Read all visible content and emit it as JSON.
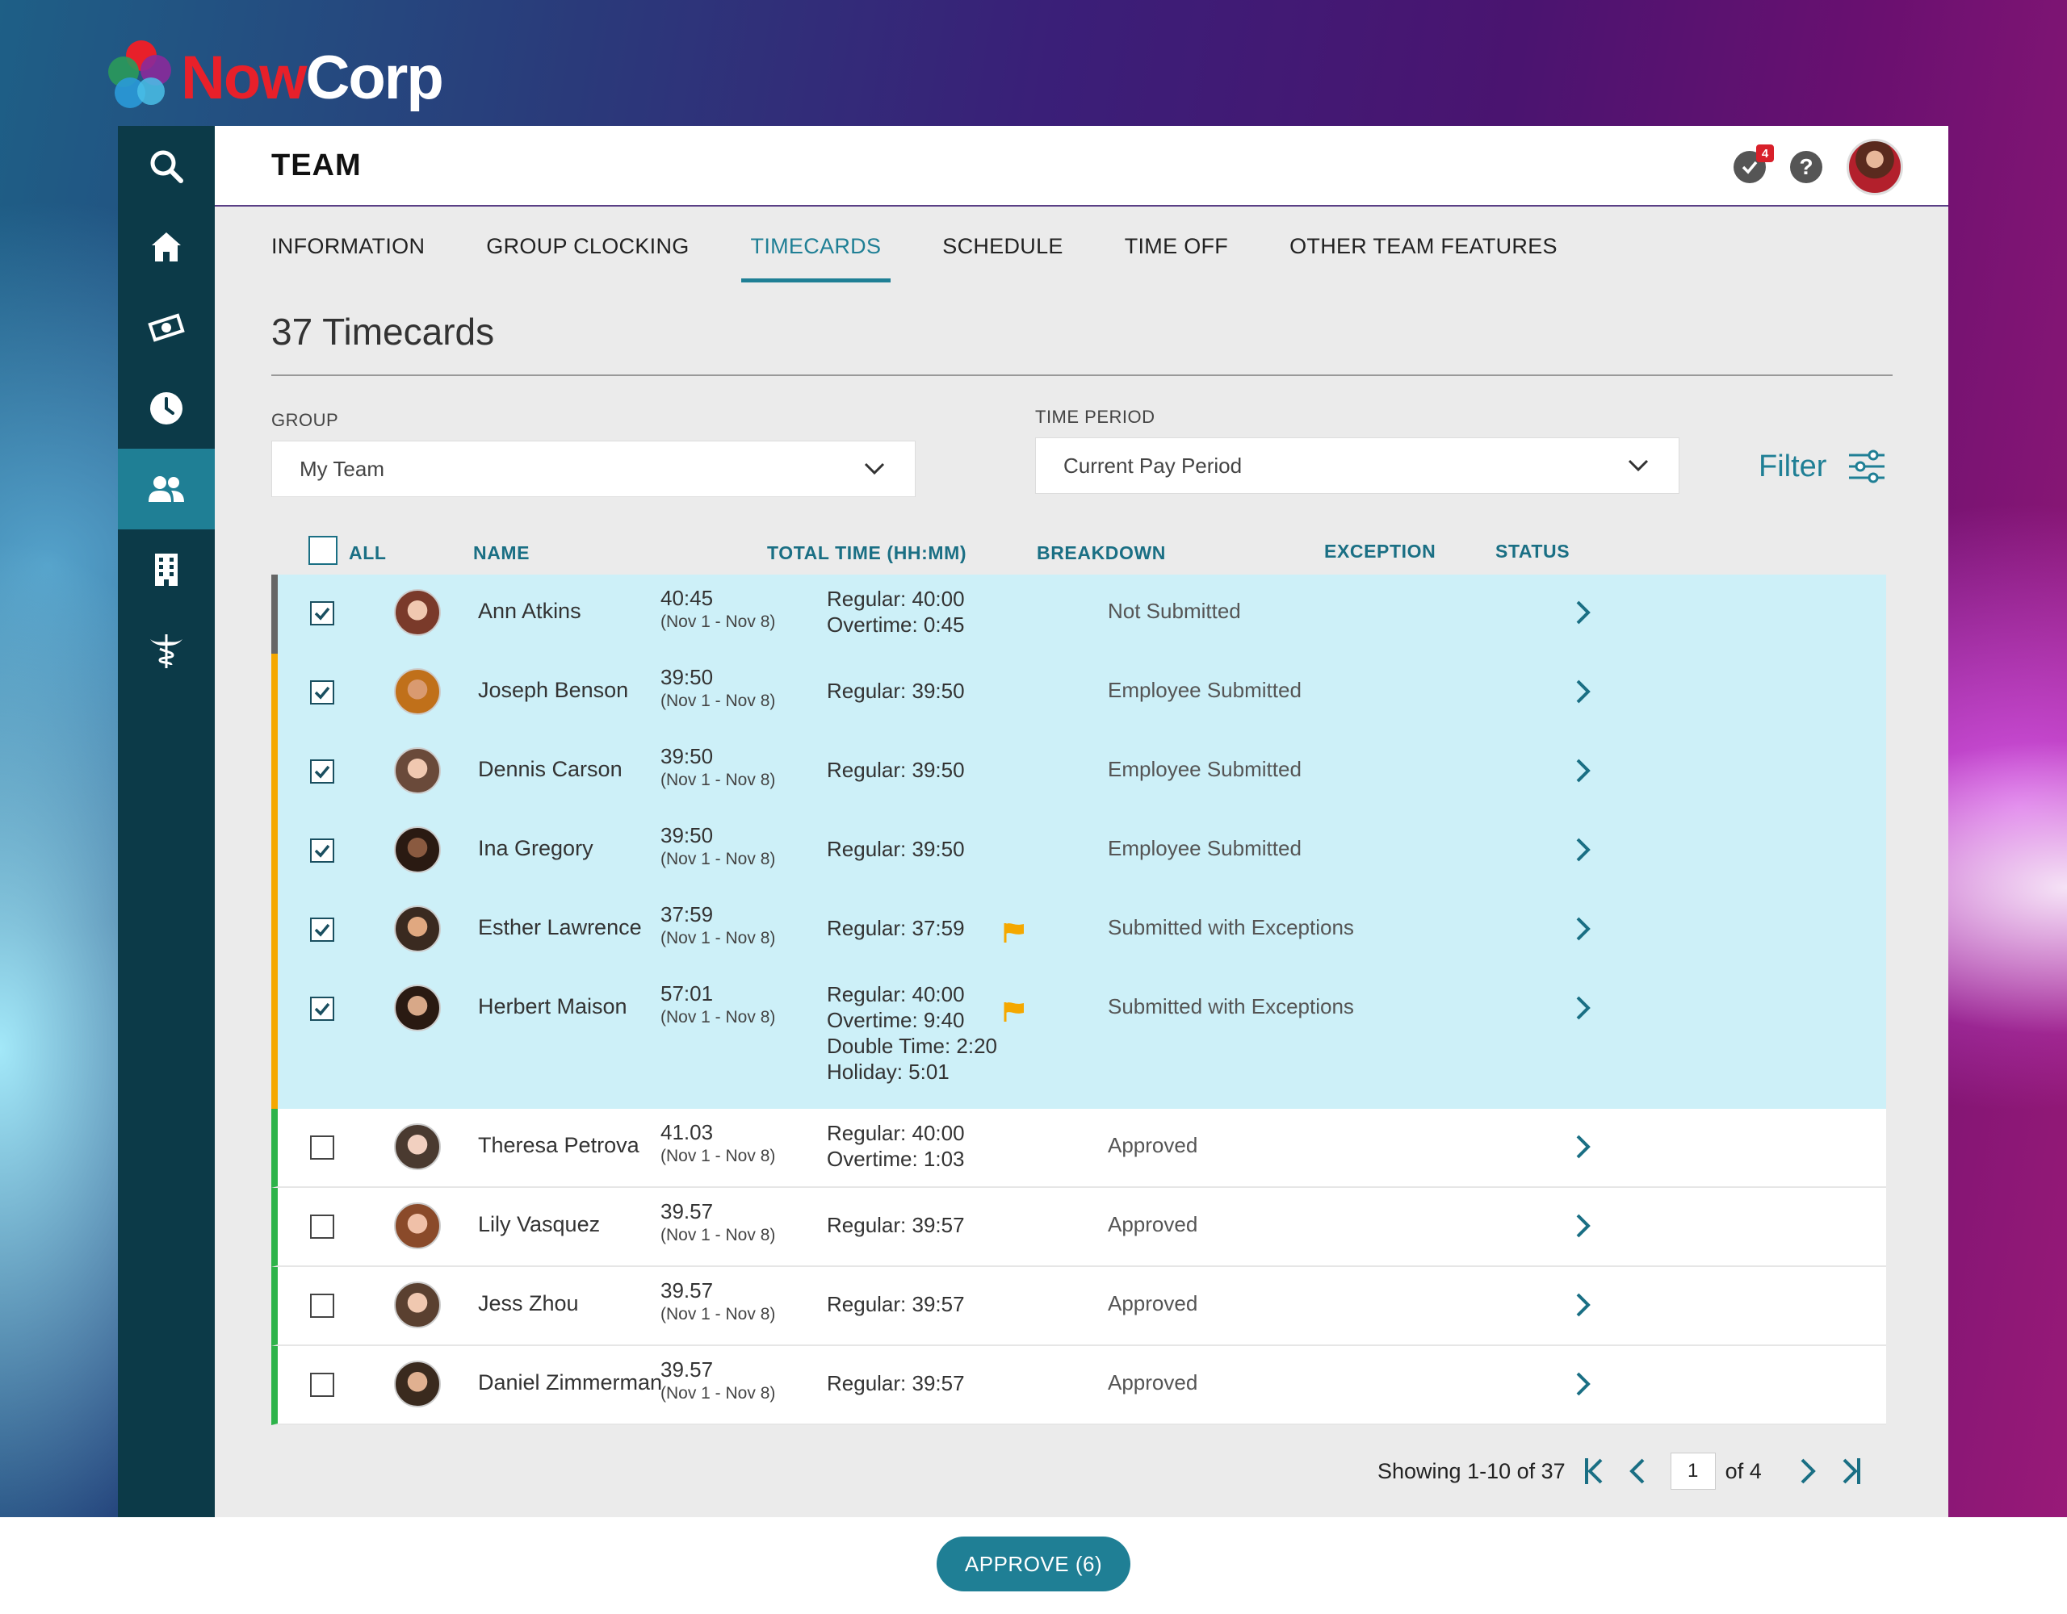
{
  "brand": {
    "now": "Now",
    "corp": "Corp"
  },
  "header": {
    "title": "TEAM",
    "notification_count": "4",
    "help_symbol": "?"
  },
  "sidebar": {
    "items": [
      {
        "name": "search",
        "icon": "search-icon"
      },
      {
        "name": "home",
        "icon": "home-icon"
      },
      {
        "name": "pay",
        "icon": "money-icon"
      },
      {
        "name": "time",
        "icon": "clock-icon"
      },
      {
        "name": "team",
        "icon": "people-icon",
        "active": true
      },
      {
        "name": "company",
        "icon": "building-icon"
      },
      {
        "name": "benefits",
        "icon": "caduceus-icon"
      }
    ]
  },
  "tabs": [
    "INFORMATION",
    "GROUP CLOCKING",
    "TIMECARDS",
    "SCHEDULE",
    "TIME OFF",
    "OTHER TEAM FEATURES"
  ],
  "active_tab": "TIMECARDS",
  "page": {
    "heading": "37 Timecards"
  },
  "filters": {
    "group_label": "GROUP",
    "group_value": "My Team",
    "period_label": "TIME PERIOD",
    "period_value": "Current Pay Period",
    "filter_label": "Filter"
  },
  "table": {
    "headers": {
      "all": "ALL",
      "name": "NAME",
      "total": "TOTAL TIME (HH:MM)",
      "breakdown": "BREAKDOWN",
      "exception": "EXCEPTION",
      "status": "STATUS"
    },
    "rows": [
      {
        "name": "Ann Atkins",
        "total": "40:45",
        "range": "(Nov 1 - Nov 8)",
        "breakdown": [
          "Regular: 40:00",
          "Overtime: 0:45"
        ],
        "exception": false,
        "status": "Not Submitted",
        "checked": true,
        "marker": "#666666"
      },
      {
        "name": "Joseph Benson",
        "total": "39:50",
        "range": "(Nov 1 - Nov 8)",
        "breakdown": [
          "Regular: 39:50"
        ],
        "exception": false,
        "status": "Employee Submitted",
        "checked": true,
        "marker": "#f5a800"
      },
      {
        "name": "Dennis Carson",
        "total": "39:50",
        "range": "(Nov 1 - Nov 8)",
        "breakdown": [
          "Regular: 39:50"
        ],
        "exception": false,
        "status": "Employee Submitted",
        "checked": true,
        "marker": "#f5a800"
      },
      {
        "name": "Ina Gregory",
        "total": "39:50",
        "range": "(Nov 1 - Nov 8)",
        "breakdown": [
          "Regular: 39:50"
        ],
        "exception": false,
        "status": "Employee Submitted",
        "checked": true,
        "marker": "#f5a800"
      },
      {
        "name": "Esther Lawrence",
        "total": "37:59",
        "range": "(Nov 1 - Nov 8)",
        "breakdown": [
          "Regular: 37:59"
        ],
        "exception": true,
        "status": "Submitted with Exceptions",
        "checked": true,
        "marker": "#f5a800"
      },
      {
        "name": "Herbert Maison",
        "total": "57:01",
        "range": "(Nov 1 - Nov 8)",
        "breakdown": [
          "Regular: 40:00",
          "Overtime: 9:40",
          "Double Time: 2:20",
          "Holiday: 5:01"
        ],
        "exception": true,
        "status": "Submitted with Exceptions",
        "checked": true,
        "marker": "#f5a800"
      },
      {
        "name": "Theresa Petrova",
        "total": "41.03",
        "range": "(Nov 1 - Nov 8)",
        "breakdown": [
          "Regular: 40:00",
          "Overtime: 1:03"
        ],
        "exception": false,
        "status": "Approved",
        "checked": false,
        "marker": "#2db34a"
      },
      {
        "name": "Lily Vasquez",
        "total": "39.57",
        "range": "(Nov 1 - Nov 8)",
        "breakdown": [
          "Regular: 39:57"
        ],
        "exception": false,
        "status": "Approved",
        "checked": false,
        "marker": "#2db34a"
      },
      {
        "name": "Jess Zhou",
        "total": "39.57",
        "range": "(Nov 1 - Nov 8)",
        "breakdown": [
          "Regular: 39:57"
        ],
        "exception": false,
        "status": "Approved",
        "checked": false,
        "marker": "#2db34a"
      },
      {
        "name": "Daniel Zimmerman",
        "total": "39.57",
        "range": "(Nov 1 - Nov 8)",
        "breakdown": [
          "Regular: 39:57"
        ],
        "exception": false,
        "status": "Approved",
        "checked": false,
        "marker": "#2db34a"
      }
    ]
  },
  "pagination": {
    "showing": "Showing 1-10 of 37",
    "page": "1",
    "of": "of 4"
  },
  "actions": {
    "approve_label": "APPROVE (6)"
  },
  "colors": {
    "accent": "#1f7f95",
    "sidebar": "#0c3a48",
    "selected_row": "#cdf0f8",
    "brand_red": "#e8202a",
    "flag": "#f5a800"
  }
}
